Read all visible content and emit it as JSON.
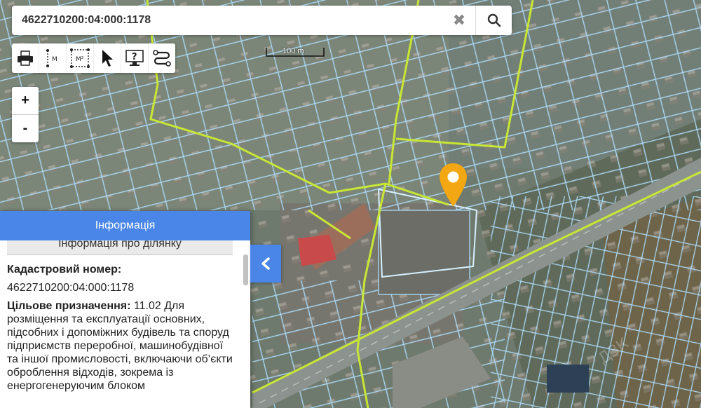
{
  "search": {
    "value": "4622710200:04:000:1178",
    "clear_icon": "close-icon",
    "search_icon": "search-icon"
  },
  "toolbar": {
    "tools": [
      {
        "name": "print-icon",
        "label": ""
      },
      {
        "name": "measure-distance-icon",
        "label": "M"
      },
      {
        "name": "measure-area-icon",
        "label": "M²"
      },
      {
        "name": "cursor-icon",
        "label": ""
      },
      {
        "name": "info-icon",
        "label": ""
      },
      {
        "name": "route-icon",
        "label": ""
      }
    ]
  },
  "zoom": {
    "in": "+",
    "out": "-"
  },
  "scale": {
    "label": "100 m"
  },
  "panel": {
    "title": "Інформація",
    "subtitle": "Інформація про ділянку",
    "cadastral_label": "Кадастровий номер:",
    "cadastral_value": "4622710200:04:000:1178",
    "purpose_label": "Цільове призначення:",
    "purpose_value": " 11.02 Для розміщення та експлуатації основних, підсобних і допоміжних будівель та споруд підприємств переробної, машинобудівної та іншої промисловості, включаючи об’єкти оброблення відходів, зокрема із енергогенеруючим блоком"
  },
  "colors": {
    "accent": "#4a86e8",
    "parcel_outline": "#a9d6f2",
    "boundary_line": "#c8e635",
    "pin": "#f3a712"
  }
}
